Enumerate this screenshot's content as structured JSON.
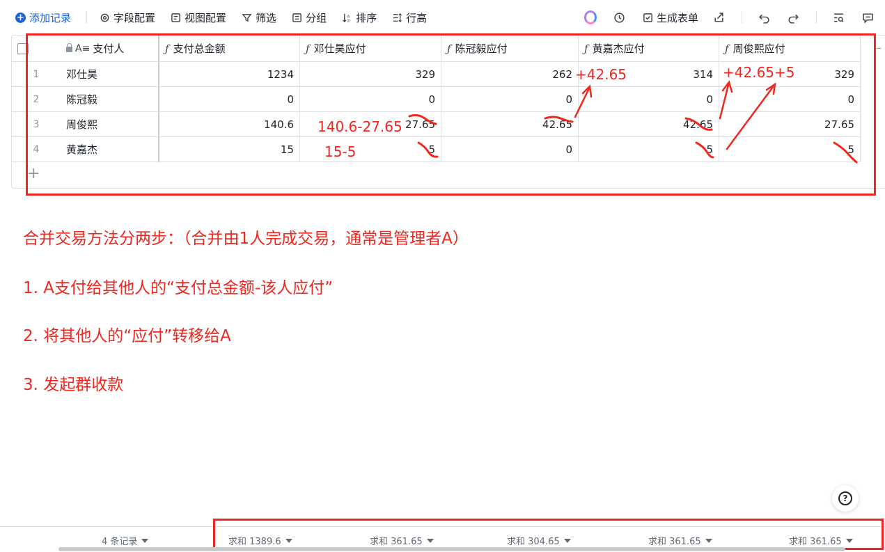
{
  "toolbar": {
    "add_record": "添加记录",
    "field_config": "字段配置",
    "view_config": "视图配置",
    "filter": "筛选",
    "group": "分组",
    "sort": "排序",
    "row_height": "行高",
    "generate_form": "生成表单"
  },
  "table": {
    "columns": [
      "支付人",
      "支付总金额",
      "邓仕昊应付",
      "陈冠毅应付",
      "黄嘉杰应付",
      "周俊熙应付"
    ],
    "rows": [
      {
        "num": "1",
        "name": "邓仕昊",
        "total": "1234",
        "deng": "329",
        "chen": "262",
        "huang": "314",
        "zhou": "329"
      },
      {
        "num": "2",
        "name": "陈冠毅",
        "total": "0",
        "deng": "0",
        "chen": "0",
        "huang": "0",
        "zhou": "0"
      },
      {
        "num": "3",
        "name": "周俊熙",
        "total": "140.6",
        "deng": "27.65",
        "chen": "42.65",
        "huang": "42.65",
        "zhou": "27.65"
      },
      {
        "num": "4",
        "name": "黄嘉杰",
        "total": "15",
        "deng": "5",
        "chen": "0",
        "huang": "5",
        "zhou": "5"
      }
    ]
  },
  "annotations": {
    "plus_chen": "+42.65",
    "plus_zhou": "+42.65+5",
    "calc_row3": "140.6-27.65",
    "calc_row4": "15-5"
  },
  "notes": {
    "line1": "合并交易方法分两步：（合并由1人完成交易，通常是管理者A）",
    "line2": "1. A支付给其他人的“支付总金额-该人应付”",
    "line3": "2. 将其他人的“应付”转移给A",
    "line4": "3. 发起群收款"
  },
  "footer": {
    "record_count": "4 条记录",
    "sums": [
      "求和 1389.6",
      "求和 361.65",
      "求和 304.65",
      "求和 361.65",
      "求和 361.65"
    ]
  },
  "colors": {
    "annotation": "#f0261f",
    "accent": "#1f62d6"
  },
  "icons": [
    "plus-circle-icon",
    "gear-icon",
    "view-config-icon",
    "filter-icon",
    "group-icon",
    "sort-icon",
    "row-height-icon",
    "ai-icon",
    "history-icon",
    "form-icon",
    "share-icon",
    "undo-icon",
    "redo-icon",
    "search-icon",
    "comment-icon",
    "help-icon",
    "lock-icon",
    "formula-icon"
  ]
}
